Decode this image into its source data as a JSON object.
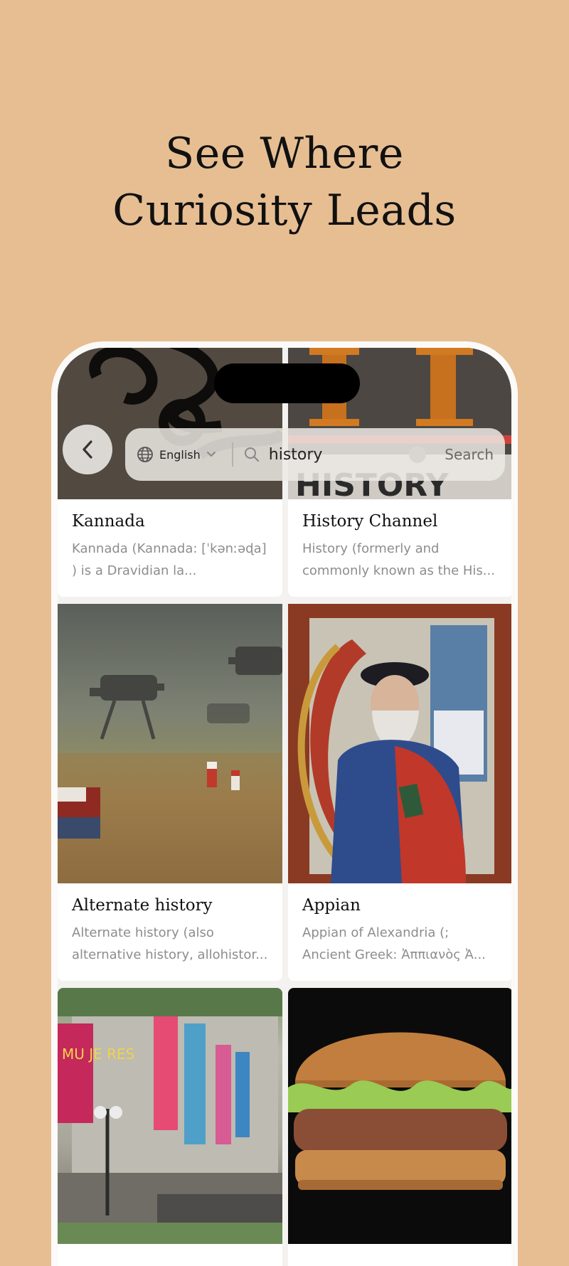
{
  "headline": {
    "line1": "See Where",
    "line2": "Curiosity Leads"
  },
  "search": {
    "language": "English",
    "query": "history",
    "button": "Search"
  },
  "results": [
    {
      "title": "Kannada",
      "desc": "Kannada (Kannada: [ˈkənːəɖa] ) is a Dravidian la..."
    },
    {
      "title": "History Channel",
      "desc": "History (formerly and commonly known as the His..."
    },
    {
      "title": "Alternate history",
      "desc": "Alternate history (also alternative history, allohistor..."
    },
    {
      "title": "Appian",
      "desc": "Appian of Alexandria (; Ancient Greek: Ἀππιανὸς Ἀ..."
    }
  ],
  "thumb_text": {
    "museum_banner": "MU JE RES"
  },
  "colors": {
    "background": "#E7BE92",
    "card": "#FFFFFF",
    "title": "#111111",
    "desc": "#8D8D8D"
  }
}
